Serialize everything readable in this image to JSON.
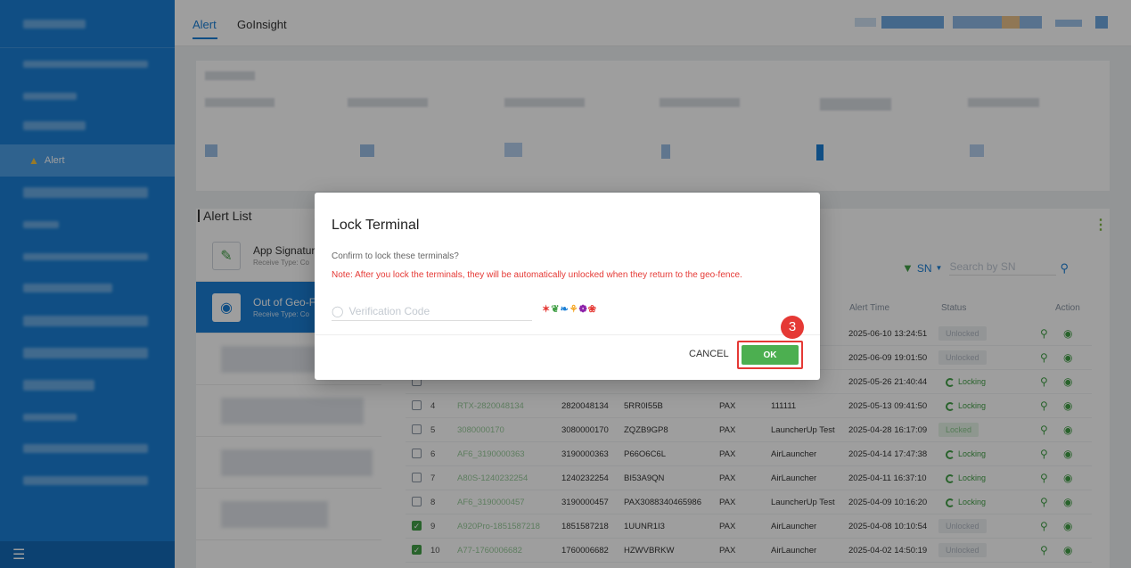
{
  "sidebar": {
    "active_item": "Alert"
  },
  "topbar": {
    "tabs": [
      "Alert",
      "GoInsight"
    ]
  },
  "alert_list": {
    "title": "Alert List",
    "categories": [
      {
        "title": "App Signature",
        "subtitle": "Receive Type: Co"
      },
      {
        "title": "Out of Geo-Fe",
        "subtitle": "Receive Type: Co"
      }
    ]
  },
  "table": {
    "filter_field": "SN",
    "search_placeholder": "Search by SN",
    "headers": {
      "time": "Alert Time",
      "status": "Status",
      "action": "Action"
    },
    "rows": [
      {
        "idx": "",
        "name": "",
        "sn": "",
        "model": "",
        "brand": "",
        "app": "",
        "time": "2025-06-10 13:24:51",
        "status": "Unlocked",
        "checked": false
      },
      {
        "idx": "",
        "name": "",
        "sn": "",
        "model": "",
        "brand": "",
        "app": "",
        "time": "2025-06-09 19:01:50",
        "status": "Unlocked",
        "checked": false
      },
      {
        "idx": "",
        "name": "",
        "sn": "",
        "model": "",
        "brand": "",
        "app": "",
        "time": "2025-05-26 21:40:44",
        "status": "Locking",
        "checked": false
      },
      {
        "idx": "4",
        "name": "RTX-2820048134",
        "sn": "2820048134",
        "model": "5RR0I55B",
        "brand": "PAX",
        "app": "111111",
        "time": "2025-05-13 09:41:50",
        "status": "Locking",
        "checked": false
      },
      {
        "idx": "5",
        "name": "3080000170",
        "sn": "3080000170",
        "model": "ZQZB9GP8",
        "brand": "PAX",
        "app": "LauncherUp Test",
        "time": "2025-04-28 16:17:09",
        "status": "Locked",
        "checked": false
      },
      {
        "idx": "6",
        "name": "AF6_3190000363",
        "sn": "3190000363",
        "model": "P66O6C6L",
        "brand": "PAX",
        "app": "AirLauncher",
        "time": "2025-04-14 17:47:38",
        "status": "Locking",
        "checked": false
      },
      {
        "idx": "7",
        "name": "A80S-1240232254",
        "sn": "1240232254",
        "model": "BI53A9QN",
        "brand": "PAX",
        "app": "AirLauncher",
        "time": "2025-04-11 16:37:10",
        "status": "Locking",
        "checked": false
      },
      {
        "idx": "8",
        "name": "AF6_3190000457",
        "sn": "3190000457",
        "model": "PAX3088340465986",
        "brand": "PAX",
        "app": "LauncherUp Test",
        "time": "2025-04-09 10:16:20",
        "status": "Locking",
        "checked": false
      },
      {
        "idx": "9",
        "name": "A920Pro-1851587218",
        "sn": "1851587218",
        "model": "1UUNR1I3",
        "brand": "PAX",
        "app": "AirLauncher",
        "time": "2025-04-08 10:10:54",
        "status": "Unlocked",
        "checked": true
      },
      {
        "idx": "10",
        "name": "A77-1760006682",
        "sn": "1760006682",
        "model": "HZWVBRKW",
        "brand": "PAX",
        "app": "AirLauncher",
        "time": "2025-04-02 14:50:19",
        "status": "Unlocked",
        "checked": true
      }
    ]
  },
  "dialog": {
    "title": "Lock Terminal",
    "confirm_text": "Confirm to lock these terminals?",
    "note": "Note: After you lock the terminals, they will be automatically unlocked when they return to the geo-fence.",
    "verification_placeholder": "Verification Code",
    "captcha_chars": [
      "✶",
      "❦",
      "❧",
      "⚘",
      "❁",
      "❀"
    ],
    "cancel_label": "CANCEL",
    "ok_label": "OK",
    "step_badge": "3"
  },
  "colors": {
    "brand_blue": "#1a7fd6",
    "green": "#4caf50",
    "highlight_red": "#e53935"
  }
}
